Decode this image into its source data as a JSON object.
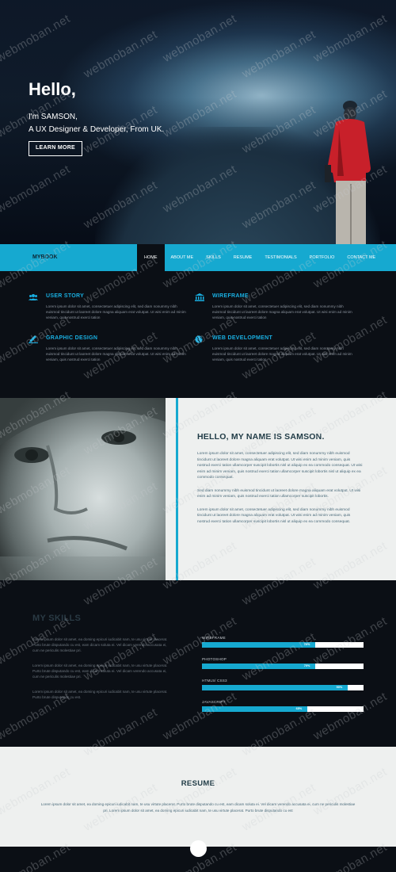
{
  "hero": {
    "title": "Hello,",
    "line1": "I'm SAMSON,",
    "line2": "A UX Designer & Developer, From UK.",
    "button": "LEARN MORE"
  },
  "nav": {
    "logo": "MYBOOK",
    "items": [
      "HOME",
      "ABOUT ME",
      "SKILLS",
      "RESUME",
      "TESTIMONIALS",
      "PORTFOLIO",
      "CONTACT ME"
    ],
    "active": "HOME"
  },
  "services": [
    {
      "title": "USER STORY",
      "icon": "users-icon",
      "text": "Lorem ipsum dolor sit amet, consectetuer adipiscing elit, sed diam nonummy nibh euismod tincidunt ut laoreet dolore magna aliquam erat volutpat. Ut wisi enim ad minim veniam, quis nostrud exerci tation"
    },
    {
      "title": "WIREFRAME",
      "icon": "bank-icon",
      "text": "Lorem ipsum dolor sit amet, consectetuer adipiscing elit, sed diam nonummy nibh euismod tincidunt ut laoreet dolore magna aliquam erat volutpat. Ut wisi enim ad minim veniam, quis nostrud exerci tation"
    },
    {
      "title": "GRAPHIC DESIGN",
      "icon": "pencil-icon",
      "text": "Lorem ipsum dolor sit amet, consectetuer adipiscing elit, sed diam nonummy nibh euismod tincidunt ut laoreet dolore magna aliquam erat volutpat. Ut wisi enim ad minim veniam, quis nostrud exerci tation"
    },
    {
      "title": "WEB DEVELOPMENT",
      "icon": "globe-icon",
      "text": "Lorem ipsum dolor sit amet, consectetuer adipiscing elit, sed diam nonummy nibh euismod tincidunt ut laoreet dolore magna aliquam erat volutpat. Ut wisi enim ad minim veniam, quis nostrud exerci tation"
    }
  ],
  "about": {
    "title": "HELLO, MY NAME IS SAMSON.",
    "p1": "Lorem ipsum dolor sit amet, consectetuer adipiscing elit, sed diam nonummy nibh euismod tincidunt ut laoreet dolore magna aliquam erat volutpat. Ut wisi enim ad minim veniam, quis nostrud exerci tation ullamcorper suscipit lobortis nisl ut aliquip ex ea commodo consequat. Ut wisi enim ad minim veniam, quis nostrud exerci tation ullamcorper suscipit lobortis nisl ut aliquip ex ea commodo consequat.",
    "p2": "Sed diam nonummy nibh euismod tincidunt ut laoreet dolore magna aliquam erat volutpat. Ut wisi enim ad minim veniam, quis nostrud exerci tation ullamcorper suscipit lobortis.",
    "p3": "Lorem ipsum dolor sit amet, consectetuer adipiscing elit, sed diam nonummy nibh euismod tincidunt ut laoreet dolore magna aliquam erat volutpat. Ut wisi enim ad minim veniam, quis nostrud exerci tation ullamcorper suscipit lobortis nisl ut aliquip ex ea commodo consequat."
  },
  "skills": {
    "title": "MY SKILLS",
    "p1": "Lorem ipsum dolor sit amet, ea doming epicuri iudicabit nam, te usu virtute placerat. Purto brute disputando cu est, eam dicam soluta ei. Vel dicam verendo accusata ei, cum ne periculis molestiae pri.",
    "p2": "Lorem ipsum dolor sit amet, ea doming epicuri iudicabit nam, te usu virtute placerat. Purto brute disputando cu est, eam dicam soluta ei. Vel dicam verendo accusata ei, cum ne periculis molestiae pri.",
    "p3": "Lorem ipsum dolor sit amet, ea doming epicuri iudicabit nam, te usu virtute placerat. Purto brute disputando cu est.",
    "bars": [
      {
        "name": "WIREFRAME",
        "percent": 70,
        "label": "70%"
      },
      {
        "name": "PHOTOSHOP",
        "percent": 70,
        "label": "70%"
      },
      {
        "name": "HTML5/ CSS3",
        "percent": 90,
        "label": "90%"
      },
      {
        "name": "JAVASCRIPT",
        "percent": 65,
        "label": "65%"
      }
    ]
  },
  "resume": {
    "title": "RESUME",
    "text": "Lorem ipsum dolor sit amet, ea doming epicuri iudicabit nam, te usu virtute placerat. Purto brute disputando cu est, eam dicam soluta ei. Vel dicam verendo accusata ei, cum ne periculis molestiae pri. Lorem ipsum dolor sit amet, ea doming epicuri iudicabit nam, te usu virtute placerat. Purto brute disputando cu est"
  },
  "watermark": "webmoban.net",
  "colors": {
    "accent": "#16a9d0",
    "dark": "#0b0f15",
    "light": "#eef0ef",
    "jacket": "#c8202a"
  }
}
